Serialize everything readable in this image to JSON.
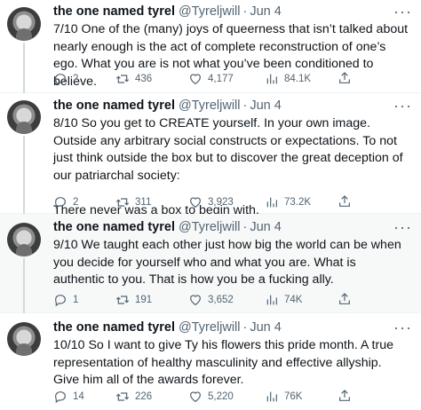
{
  "tweets": [
    {
      "name": "the one named tyrel",
      "handle": "@Tyreljwill",
      "dot": "·",
      "date": "Jun 4",
      "text": "7/10 One of the (many) joys of queerness that isn’t talked about nearly enough is the act of complete reconstruction of one’s ego. What you are is not what you’ve been conditioned to believe.",
      "replies": "2",
      "retweets": "436",
      "likes": "4,177",
      "views": "84.1K"
    },
    {
      "name": "the one named tyrel",
      "handle": "@Tyreljwill",
      "dot": "·",
      "date": "Jun 4",
      "text": "8/10 So you get to CREATE yourself. In your own image. Outside any arbitrary social constructs or expectations. To not just think outside the box but to discover the great deception of our patriarchal society:\n\nThere never was a box to begin with.",
      "replies": "2",
      "retweets": "311",
      "likes": "3,923",
      "views": "73.2K"
    },
    {
      "name": "the one named tyrel",
      "handle": "@Tyreljwill",
      "dot": "·",
      "date": "Jun 4",
      "text": "9/10 We taught each other just how big the world can be when you decide for yourself who and what you are. What is authentic to you. That is how you be a fucking ally.",
      "replies": "1",
      "retweets": "191",
      "likes": "3,652",
      "views": "74K"
    },
    {
      "name": "the one named tyrel",
      "handle": "@Tyreljwill",
      "dot": "·",
      "date": "Jun 4",
      "text": "10/10 So I want to give Ty his flowers this pride month. A true representation of healthy masculinity and effective allyship. Give him all of the awards forever.",
      "replies": "14",
      "retweets": "226",
      "likes": "5,220",
      "views": "76K"
    }
  ],
  "icons": {
    "more": "more-icon",
    "reply": "reply-icon",
    "retweet": "retweet-icon",
    "like": "heart-icon",
    "views": "views-icon",
    "share": "share-icon"
  },
  "colors": {
    "text": "#0f1419",
    "secondary": "#536471",
    "thread_line": "#cfd9de",
    "highlight_bg": "#f7f9f9"
  }
}
